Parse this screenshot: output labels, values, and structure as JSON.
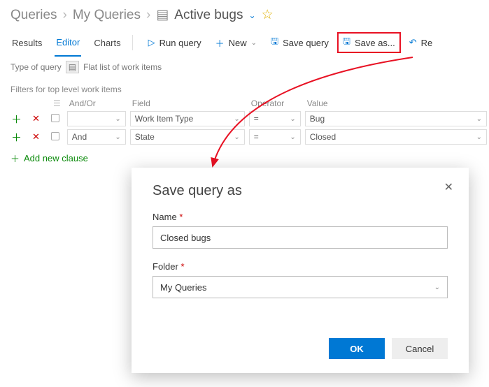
{
  "breadcrumb": {
    "root": "Queries",
    "mid": "My Queries",
    "leaf": "Active bugs"
  },
  "tabs": {
    "results": "Results",
    "editor": "Editor",
    "charts": "Charts"
  },
  "toolbar": {
    "run": "Run query",
    "new": "New",
    "save": "Save query",
    "saveas": "Save as...",
    "revert": "Re"
  },
  "querytype": {
    "label": "Type of query",
    "value": "Flat list of work items"
  },
  "filters": {
    "header": "Filters for top level work items",
    "cols": {
      "andor": "And/Or",
      "field": "Field",
      "operator": "Operator",
      "value": "Value"
    },
    "rows": [
      {
        "andor": "",
        "field": "Work Item Type",
        "op": "=",
        "val": "Bug"
      },
      {
        "andor": "And",
        "field": "State",
        "op": "=",
        "val": "Closed"
      }
    ],
    "add_clause": "Add new clause"
  },
  "modal": {
    "title": "Save query as",
    "name_label": "Name",
    "name_value": "Closed bugs",
    "folder_label": "Folder",
    "folder_value": "My Queries",
    "ok": "OK",
    "cancel": "Cancel"
  }
}
